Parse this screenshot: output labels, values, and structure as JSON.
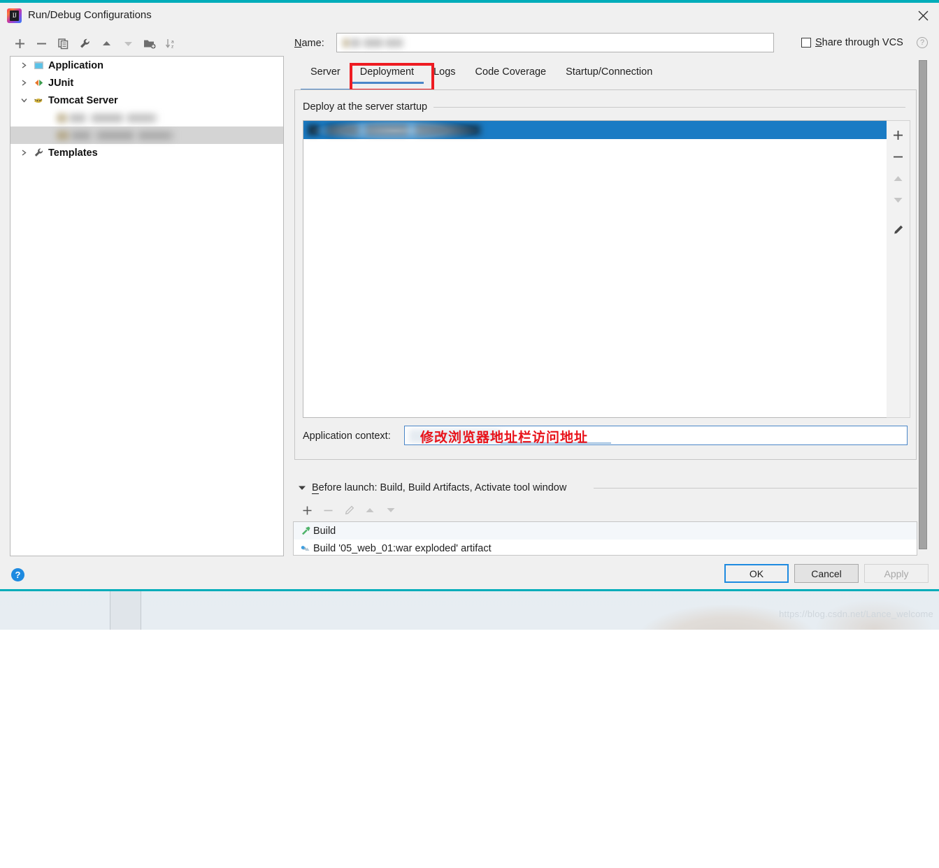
{
  "window": {
    "title": "Run/Debug Configurations",
    "logo_icon": "intellij-idea-logo",
    "close_icon": "close-icon",
    "accent_color": "#00adba"
  },
  "left_toolbar": {
    "buttons": [
      {
        "name": "add",
        "icon": "plus-icon"
      },
      {
        "name": "remove",
        "icon": "minus-icon"
      },
      {
        "name": "copy",
        "icon": "copy-icon"
      },
      {
        "name": "edit-templates",
        "icon": "wrench-icon"
      },
      {
        "name": "move-up",
        "icon": "arrow-up-icon"
      },
      {
        "name": "move-down",
        "icon": "arrow-down-icon"
      },
      {
        "name": "new-folder",
        "icon": "folder-add-icon"
      },
      {
        "name": "sort-alphabetically",
        "icon": "sort-az-icon"
      }
    ]
  },
  "tree": {
    "items": [
      {
        "label": "Application",
        "icon": "application-icon",
        "expander": "chevron-right-icon",
        "blurred": false,
        "selected": false,
        "child": false
      },
      {
        "label": "JUnit",
        "icon": "junit-icon",
        "expander": "chevron-right-icon",
        "blurred": false,
        "selected": false,
        "child": false
      },
      {
        "label": "Tomcat Server",
        "icon": "tomcat-icon",
        "expander": "chevron-down-icon",
        "blurred": false,
        "selected": false,
        "child": false
      },
      {
        "label": "",
        "icon": "tomcat-config-icon",
        "expander": "",
        "blurred": true,
        "selected": false,
        "child": true
      },
      {
        "label": "",
        "icon": "tomcat-config-icon",
        "expander": "",
        "blurred": true,
        "selected": true,
        "child": true
      },
      {
        "label": "Templates",
        "icon": "wrench-icon",
        "expander": "chevron-right-icon",
        "blurred": false,
        "selected": false,
        "child": false
      }
    ]
  },
  "name_row": {
    "label": "Name:",
    "mnemonic": "N",
    "value": "",
    "value_blurred": true
  },
  "share": {
    "label": "Share through VCS",
    "mnemonic": "S",
    "checked": false,
    "help_icon": "help-circle-icon",
    "help_glyph": "?"
  },
  "tabs": {
    "items": [
      {
        "label": "Server",
        "active": false
      },
      {
        "label": "Deployment",
        "active": true,
        "highlighted": true
      },
      {
        "label": "Logs",
        "active": false
      },
      {
        "label": "Code Coverage",
        "active": false
      },
      {
        "label": "Startup/Connection",
        "active": false
      }
    ],
    "highlight_color": "#ee1c22",
    "active_underline_color": "#4a86c8"
  },
  "deployment": {
    "group_label": "Deploy at the server startup",
    "rows": [
      {
        "label": "",
        "blurred": true,
        "selected": true
      }
    ],
    "selected_color": "#1a7bc4",
    "side_buttons": [
      {
        "name": "add-artifact",
        "icon": "plus-icon",
        "enabled": true
      },
      {
        "name": "remove-artifact",
        "icon": "minus-icon",
        "enabled": true
      },
      {
        "name": "move-artifact-up",
        "icon": "triangle-up-icon",
        "enabled": false
      },
      {
        "name": "move-artifact-down",
        "icon": "triangle-down-icon",
        "enabled": false
      },
      {
        "name": "edit-artifact",
        "icon": "pencil-icon",
        "enabled": true
      }
    ],
    "application_context": {
      "label": "Application context:",
      "value": "",
      "value_blurred": true,
      "annotation": "修改浏览器地址栏访问地址",
      "annotation_color": "#e8131a",
      "dropdown_icon": "chevron-down-icon"
    }
  },
  "before_launch": {
    "title_prefix": "B",
    "title": "efore launch: Build, Build Artifacts, Activate tool window",
    "toggle_icon": "triangle-down-icon",
    "toolbar": [
      {
        "name": "add-task",
        "icon": "plus-icon",
        "enabled": true
      },
      {
        "name": "remove-task",
        "icon": "minus-icon",
        "enabled": false
      },
      {
        "name": "edit-task",
        "icon": "pencil-icon",
        "enabled": false
      },
      {
        "name": "move-task-up",
        "icon": "triangle-up-icon",
        "enabled": false
      },
      {
        "name": "move-task-down",
        "icon": "triangle-down-icon",
        "enabled": false
      }
    ],
    "tasks": [
      {
        "label": "Build",
        "icon": "hammer-icon"
      },
      {
        "label": "Build '05_web_01:war exploded' artifact",
        "icon": "artifact-icon"
      }
    ]
  },
  "footer": {
    "help_glyph": "?",
    "ok_label": "OK",
    "cancel_label": "Cancel",
    "apply_label": "Apply",
    "apply_enabled": false
  },
  "watermark": "https://blog.csdn.net/Lance_welcome"
}
